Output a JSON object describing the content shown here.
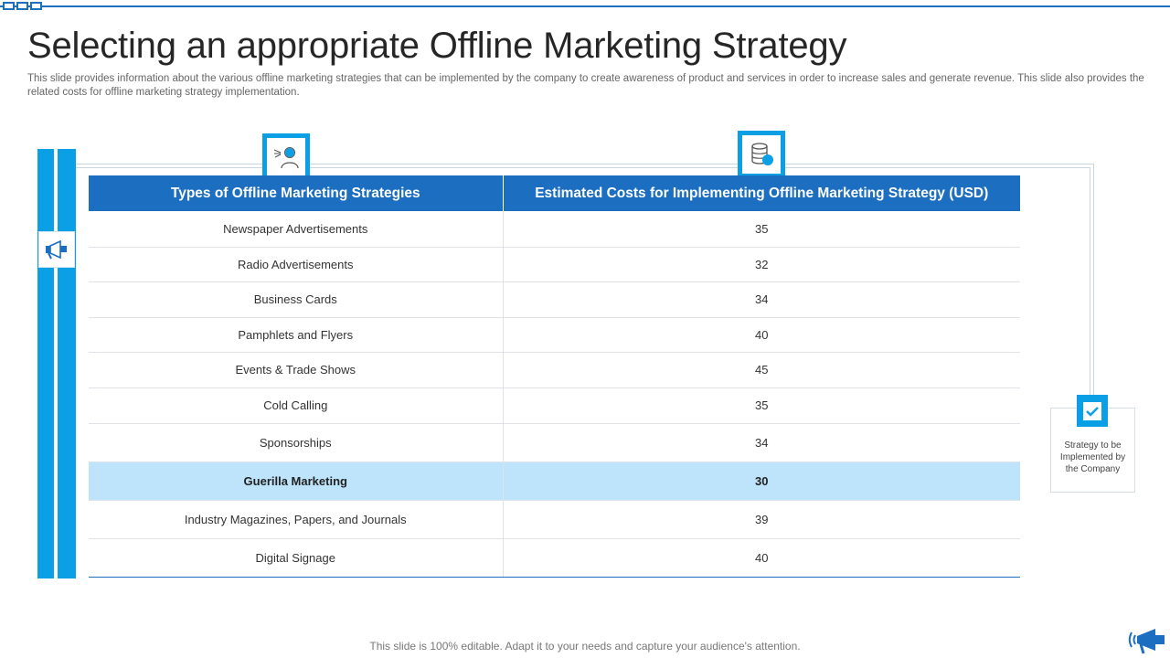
{
  "title": "Selecting an appropriate Offline Marketing Strategy",
  "subtitle": "This slide provides information about the various offline marketing strategies that can be implemented by the company to create awareness of product and services in order to increase sales and generate revenue. This slide also provides the related costs for offline marketing strategy implementation.",
  "table": {
    "headers": [
      "Types of Offline Marketing Strategies",
      "Estimated Costs for Implementing Offline Marketing Strategy (USD)"
    ],
    "rows": [
      {
        "strategy": "Newspaper  Advertisements",
        "cost": "35"
      },
      {
        "strategy": "Radio Advertisements",
        "cost": "32"
      },
      {
        "strategy": "Business Cards",
        "cost": "34"
      },
      {
        "strategy": "Pamphlets and Flyers",
        "cost": "40"
      },
      {
        "strategy": "Events & Trade Shows",
        "cost": "45"
      },
      {
        "strategy": "Cold Calling",
        "cost": "35"
      },
      {
        "strategy": "Sponsorships",
        "cost": "34"
      },
      {
        "strategy": "Guerilla Marketing",
        "cost": "30"
      },
      {
        "strategy": "Industry Magazines, Papers, and Journals",
        "cost": "39"
      },
      {
        "strategy": "Digital Signage",
        "cost": "40"
      }
    ],
    "highlighted_row": 7
  },
  "callout": {
    "text": "Strategy to be Implemented by the Company"
  },
  "icons": {
    "left": "megaphone-icon",
    "header1": "speaker-person-icon",
    "header2": "database-globe-icon",
    "callout": "checkmark-icon",
    "brand": "megaphone-icon"
  },
  "footer": "This slide is 100% editable. Adapt it to your needs and capture your audience's attention.",
  "colors": {
    "header_bg": "#1c6fc0",
    "accent": "#0b9fe6",
    "highlight_row": "#bde4fb"
  }
}
